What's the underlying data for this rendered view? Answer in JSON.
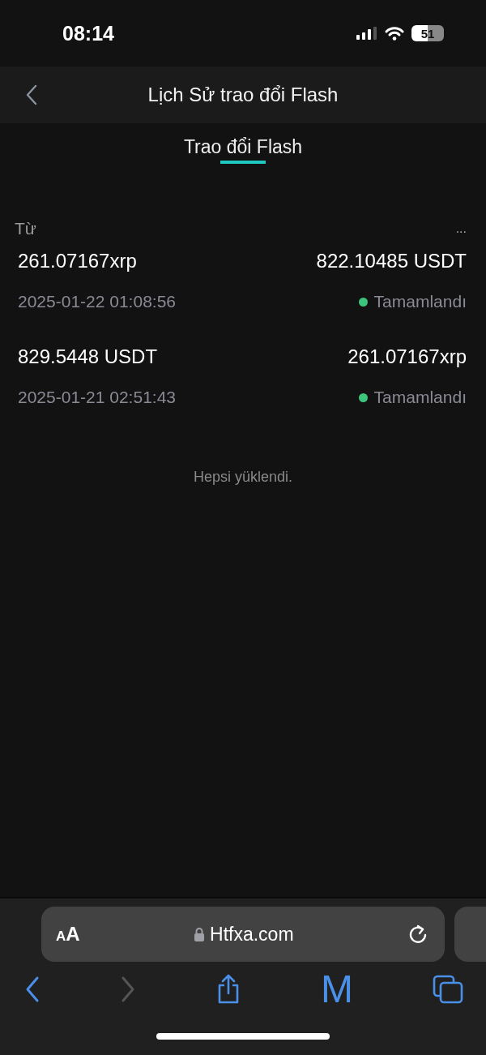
{
  "status_bar": {
    "time": "08:14",
    "battery": "51"
  },
  "header": {
    "title": "Lịch Sử trao đổi Flash"
  },
  "tabs": [
    {
      "label": "Trao đổi Flash",
      "selected": true
    }
  ],
  "list_header": {
    "label": "Từ",
    "more": "..."
  },
  "transactions": [
    {
      "from": "261.07167xrp",
      "to": "822.10485 USDT",
      "time": "2025-01-22 01:08:56",
      "status": "Tamamlandı",
      "color": "#3cc47c"
    },
    {
      "from": "829.5448 USDT",
      "to": "261.07167xrp",
      "time": "2025-01-21 02:51:43",
      "status": "Tamamlandı",
      "color": "#3cc47c"
    }
  ],
  "footer_note": "Hepsi yüklendi.",
  "browser": {
    "text_size": "AA",
    "url": "Htfxa.com",
    "toolbar": [
      {
        "kind": "back",
        "disabled": false
      },
      {
        "kind": "forward",
        "disabled": true
      },
      {
        "kind": "share",
        "disabled": false
      },
      {
        "kind": "letter",
        "text": "M",
        "disabled": false
      },
      {
        "kind": "tabs",
        "disabled": false
      }
    ]
  }
}
